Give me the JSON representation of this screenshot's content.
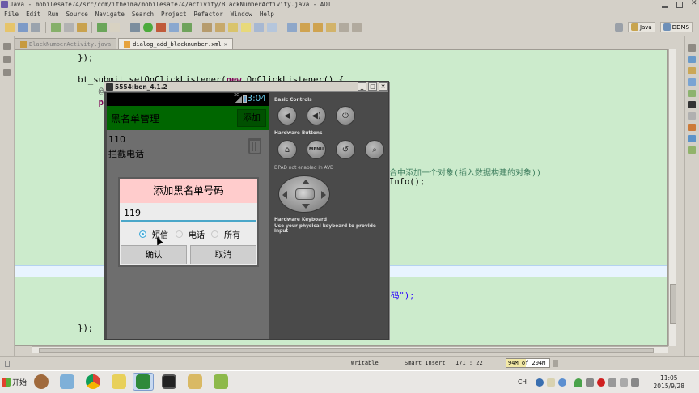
{
  "window": {
    "title": "Java - mobilesafe74/src/com/itheima/mobilesafe74/activity/BlackNumberActivity.java - ADT"
  },
  "menu": [
    "File",
    "Edit",
    "Run",
    "Source",
    "Navigate",
    "Search",
    "Project",
    "Refactor",
    "Window",
    "Help"
  ],
  "perspectives": {
    "java": "Java",
    "ddms": "DDMS"
  },
  "tabs": [
    {
      "label": "BlackNumberActivity.java",
      "active": false
    },
    {
      "label": "dialog_add_blacknumber.xml",
      "active": true
    }
  ],
  "code": {
    "l1": "    });",
    "l2_a": "    bt_submit.setOnClickListener(",
    "l2_kw": "new",
    "l2_b": " OnClickListener() {",
    "l3": "        @O",
    "l4": "        pu",
    "comment_tail": "合中添加一个对象(插入数据构建的对象))",
    "info_tail": "Info();",
    "str_tail": "码\");",
    "close1": "        }",
    "close2": "    });"
  },
  "status": {
    "writable": "Writable",
    "insert_mode": "Smart Insert",
    "position": "171 : 22",
    "heap": "94M of 204M",
    "heap_fraction": 0.46
  },
  "emulator": {
    "title": "5554:ben_4.1.2",
    "signal_label": "3G",
    "time": "3:04",
    "app_title": "黑名单管理",
    "add_button": "添加",
    "list_item": {
      "number": "110",
      "mode": "拦截电话"
    },
    "dialog": {
      "title": "添加黑名单号码",
      "input_value": "119",
      "radios": [
        {
          "label": "短信",
          "checked": true
        },
        {
          "label": "电话",
          "checked": false
        },
        {
          "label": "所有",
          "checked": false
        }
      ],
      "confirm": "确认",
      "cancel": "取消"
    },
    "controls": {
      "basic": "Basic Controls",
      "hardware": "Hardware Buttons",
      "menu_label": "MENU",
      "dpad": "DPAD not enabled in AVD",
      "keyboard_title": "Hardware Keyboard",
      "keyboard_sub": "Use your physical keyboard to provide input"
    }
  },
  "taskbar": {
    "start": "开始",
    "lang": "CH",
    "time": "11:05",
    "date": "2015/9/28"
  },
  "colors": {
    "editor_bg": "#ccebcc",
    "action_bar": "#006600",
    "dialog_title_bg": "#ffcccc",
    "radio_accent": "#41a9d8",
    "clock": "#65c6e6"
  }
}
